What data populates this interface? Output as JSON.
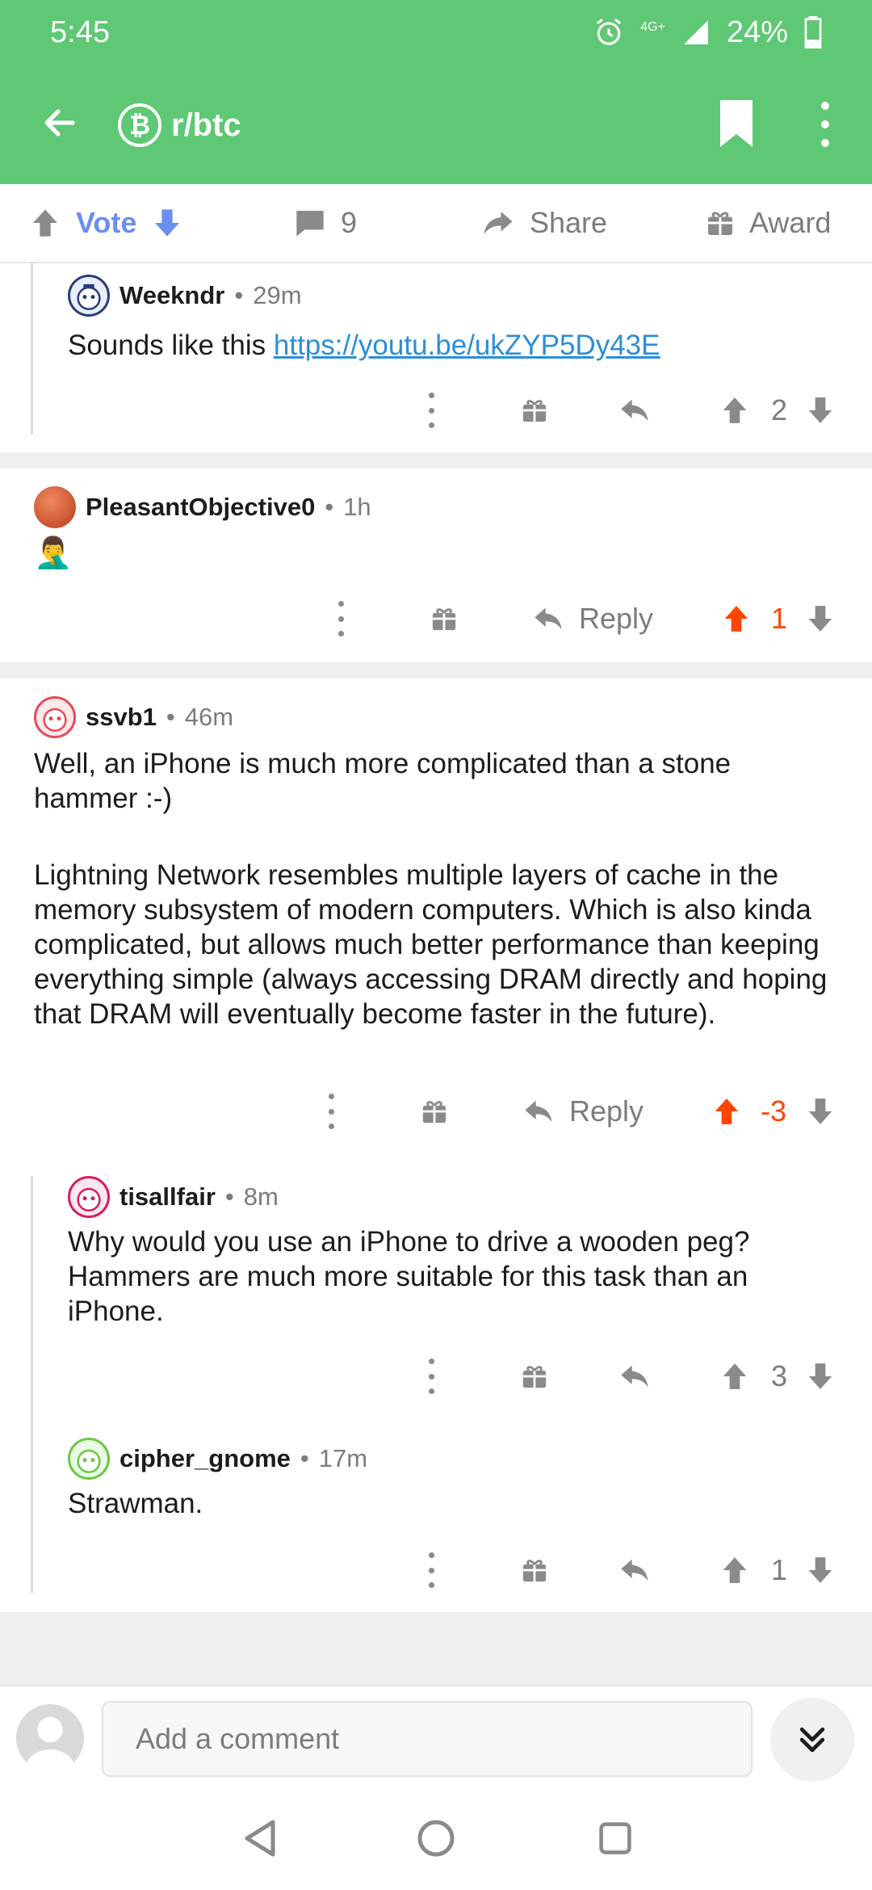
{
  "status_bar": {
    "time": "5:45",
    "network": "4G+",
    "battery": "24%"
  },
  "app_bar": {
    "subreddit": "r/btc",
    "sub_icon_letter": "₿"
  },
  "post_actions": {
    "vote_label": "Vote",
    "comment_count": "9",
    "share_label": "Share",
    "award_label": "Award"
  },
  "comments": [
    {
      "author": "Weekndr",
      "age": "29m",
      "body_prefix": "Sounds like this ",
      "link": "https://youtu.be/ukZYP5Dy43E",
      "score": "2"
    },
    {
      "author": "PleasantObjective0",
      "age": "1h",
      "emoji": "🤦‍♂️",
      "reply_label": "Reply",
      "score": "1"
    },
    {
      "author": "ssvb1",
      "age": "46m",
      "para1": "Well, an iPhone is much more complicated than a stone hammer :-)",
      "para2": "Lightning Network resembles multiple layers of cache in the memory subsystem of modern computers. Which is also kinda complicated, but allows much better performance than keeping everything simple (always accessing DRAM directly and hoping that DRAM will eventually become faster in the future).",
      "reply_label": "Reply",
      "score": "-3"
    },
    {
      "author": "tisallfair",
      "age": "8m",
      "body": "Why would you use an iPhone to drive a wooden peg? Hammers are much more suitable for this task than an iPhone.",
      "score": "3"
    },
    {
      "author": "cipher_gnome",
      "age": "17m",
      "body": "Strawman.",
      "score": "1"
    }
  ],
  "composer": {
    "placeholder": "Add a comment"
  },
  "separator_dot": "•",
  "colors": {
    "brand_green": "#5ec874",
    "upvote_orange": "#ff4500",
    "vote_blue": "#6b8ff0",
    "link_blue": "#2a8fd8"
  }
}
